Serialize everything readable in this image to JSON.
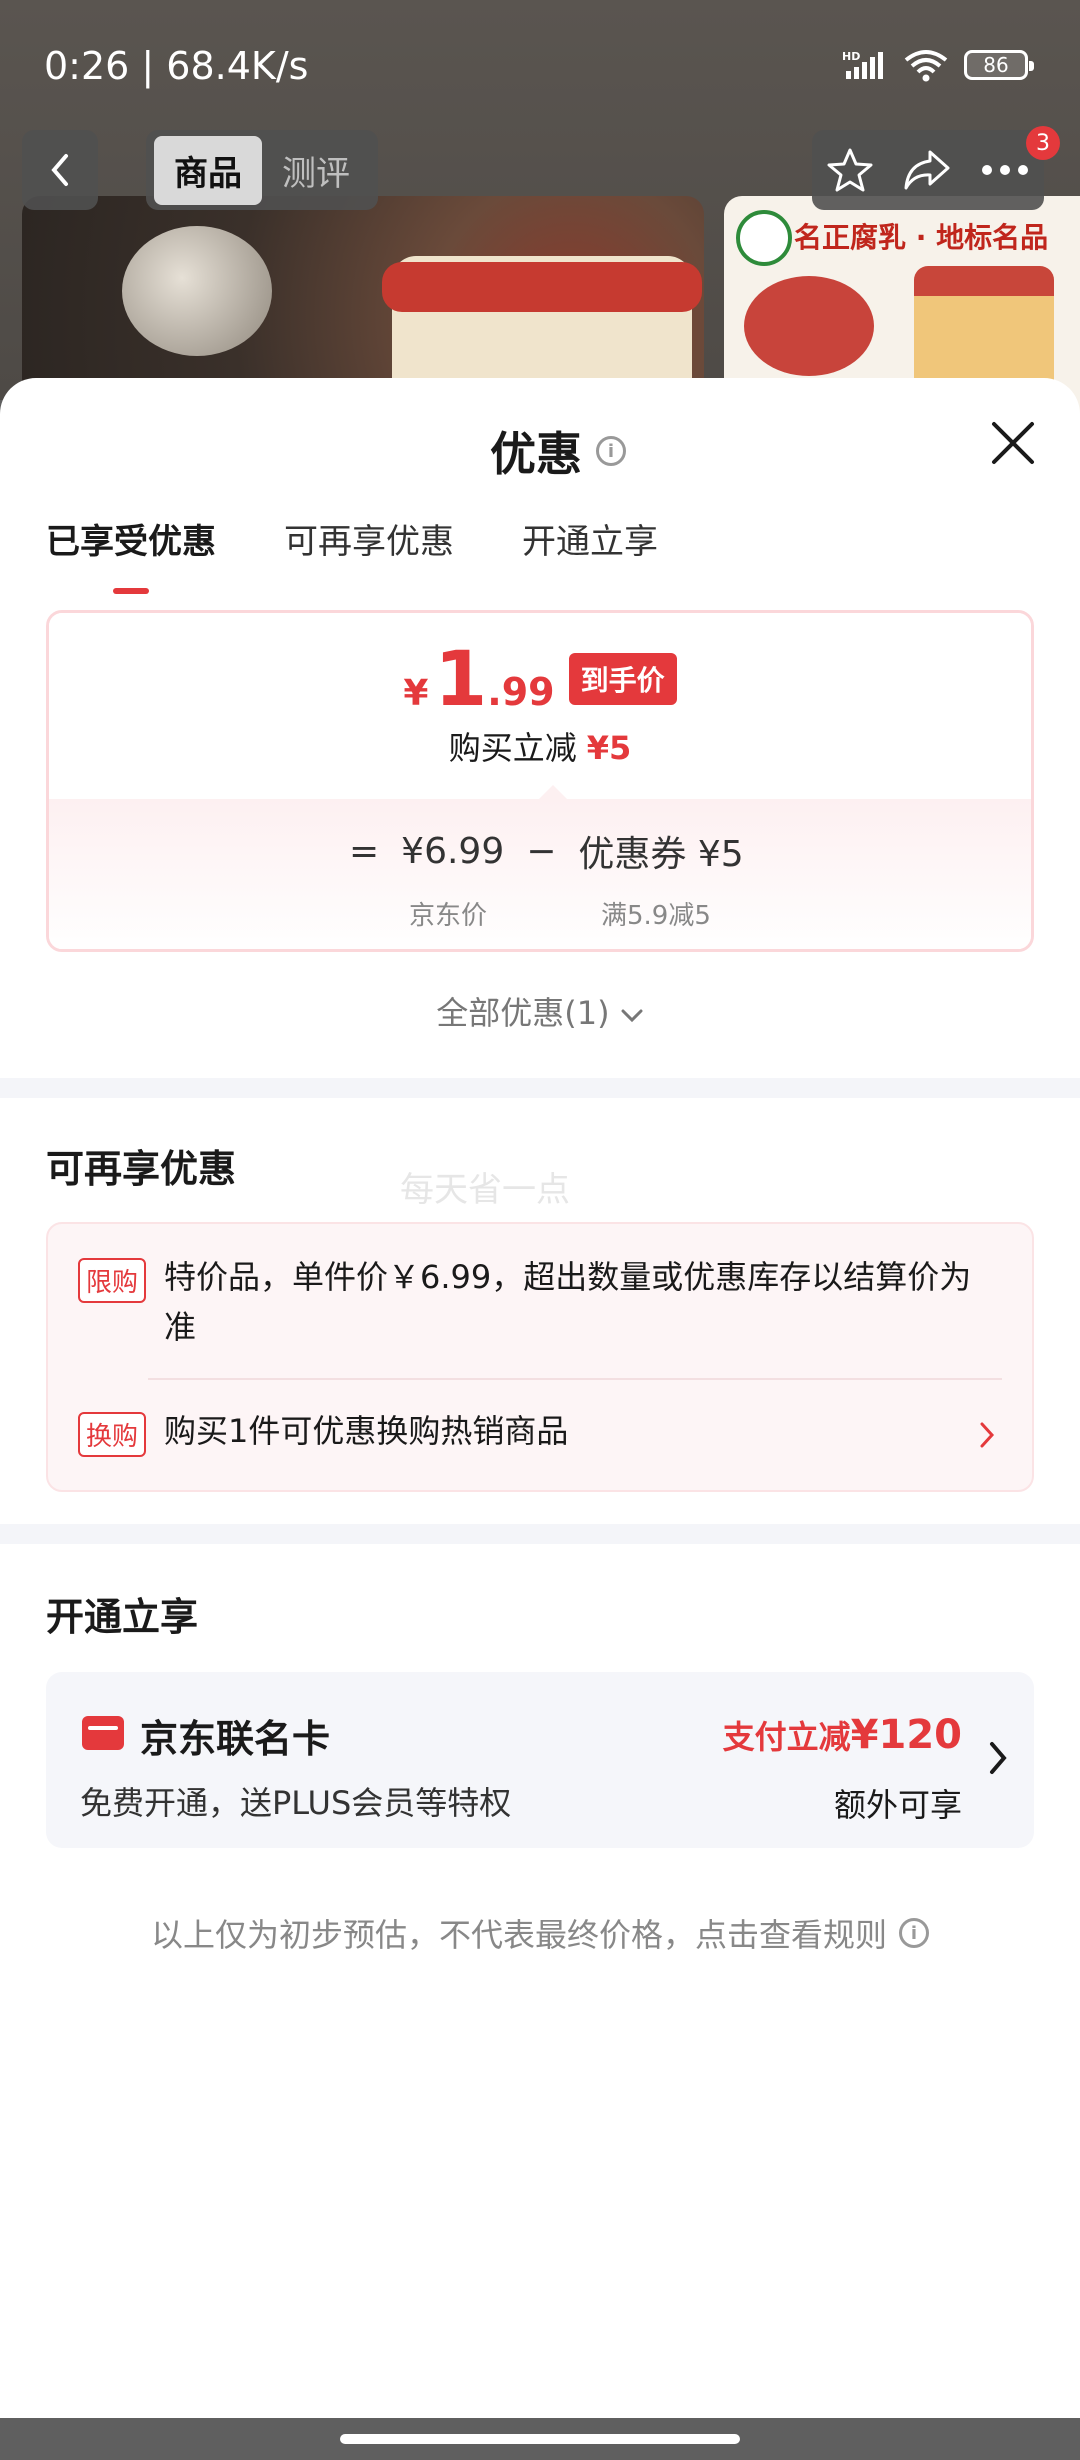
{
  "status_bar": {
    "time_speed": "0:26 | 68.4K/s",
    "battery": "86"
  },
  "top_nav": {
    "tabs": [
      "商品",
      "测评"
    ],
    "badge_count": "3"
  },
  "product_thumb": {
    "title": "名正腐乳 · 地标名品"
  },
  "sheet": {
    "title": "优惠",
    "tabs": [
      "已享受优惠",
      "可再享优惠",
      "开通立享"
    ],
    "price": {
      "yen": "¥",
      "int": "1",
      "dec": ".99",
      "tag": "到手价",
      "sub_label": "购买立减",
      "sub_value": "¥5"
    },
    "formula": {
      "eq": "=",
      "jd_price": "¥6.99",
      "minus": "−",
      "coupon": "优惠券 ¥5",
      "jd_price_label": "京东价",
      "coupon_label": "满5.9减5"
    },
    "all_offers": "全部优惠(1)"
  },
  "extra_offers": {
    "title": "可再享优惠",
    "watermark": "每天省一点",
    "items": [
      {
        "tag": "限购",
        "text": "特价品，单件价￥6.99，超出数量或优惠库存以结算价为准"
      },
      {
        "tag": "换购",
        "text": "购买1件可优惠换购热销商品"
      }
    ]
  },
  "open_enjoy": {
    "title": "开通立享",
    "card_name": "京东联名卡",
    "card_desc": "免费开通，送PLUS会员等特权",
    "promo_prefix": "支付立减",
    "promo_value": "¥120",
    "extra": "额外可享"
  },
  "disclaimer": "以上仅为初步预估，不代表最终价格，点击查看规则",
  "colors": {
    "accent": "#e4393c",
    "muted": "#888888",
    "band": "#f4f5f9"
  }
}
